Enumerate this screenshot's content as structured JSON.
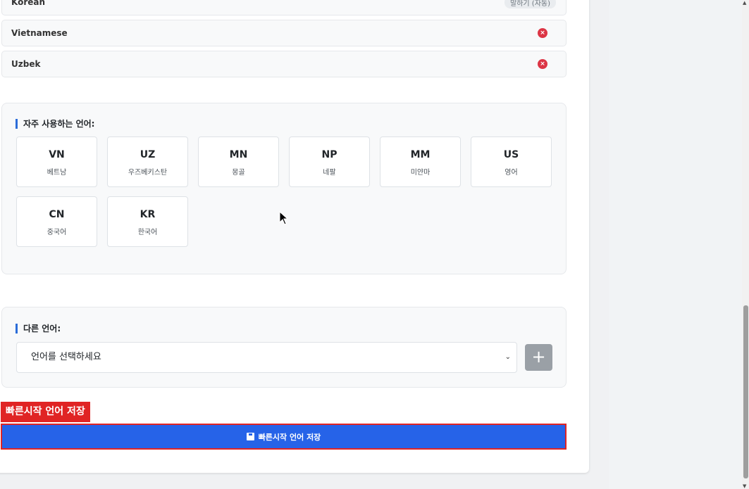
{
  "language_list": [
    {
      "name": "Korean",
      "badge": "말하기 (자동)"
    },
    {
      "name": "Vietnamese",
      "remove_icon": "×"
    },
    {
      "name": "Uzbek",
      "remove_icon": "×"
    }
  ],
  "frequent": {
    "title": "자주 사용하는 언어:",
    "languages": [
      {
        "code": "VN",
        "label": "베트남"
      },
      {
        "code": "UZ",
        "label": "우즈베키스탄"
      },
      {
        "code": "MN",
        "label": "몽골"
      },
      {
        "code": "NP",
        "label": "네팔"
      },
      {
        "code": "MM",
        "label": "미얀마"
      },
      {
        "code": "US",
        "label": "영어"
      },
      {
        "code": "CN",
        "label": "중국어"
      },
      {
        "code": "KR",
        "label": "한국어"
      }
    ]
  },
  "other": {
    "title": "다른 언어:",
    "select_value": "언어를 선택하세요",
    "add_symbol": "+"
  },
  "annotation_tag": "빠른시작 언어 저장",
  "save_button": {
    "label": "빠른시작 언어 저장",
    "icon": "save-icon"
  },
  "colors": {
    "accent": "#2663e8",
    "danger": "#dc3545",
    "highlight": "#e02424"
  }
}
